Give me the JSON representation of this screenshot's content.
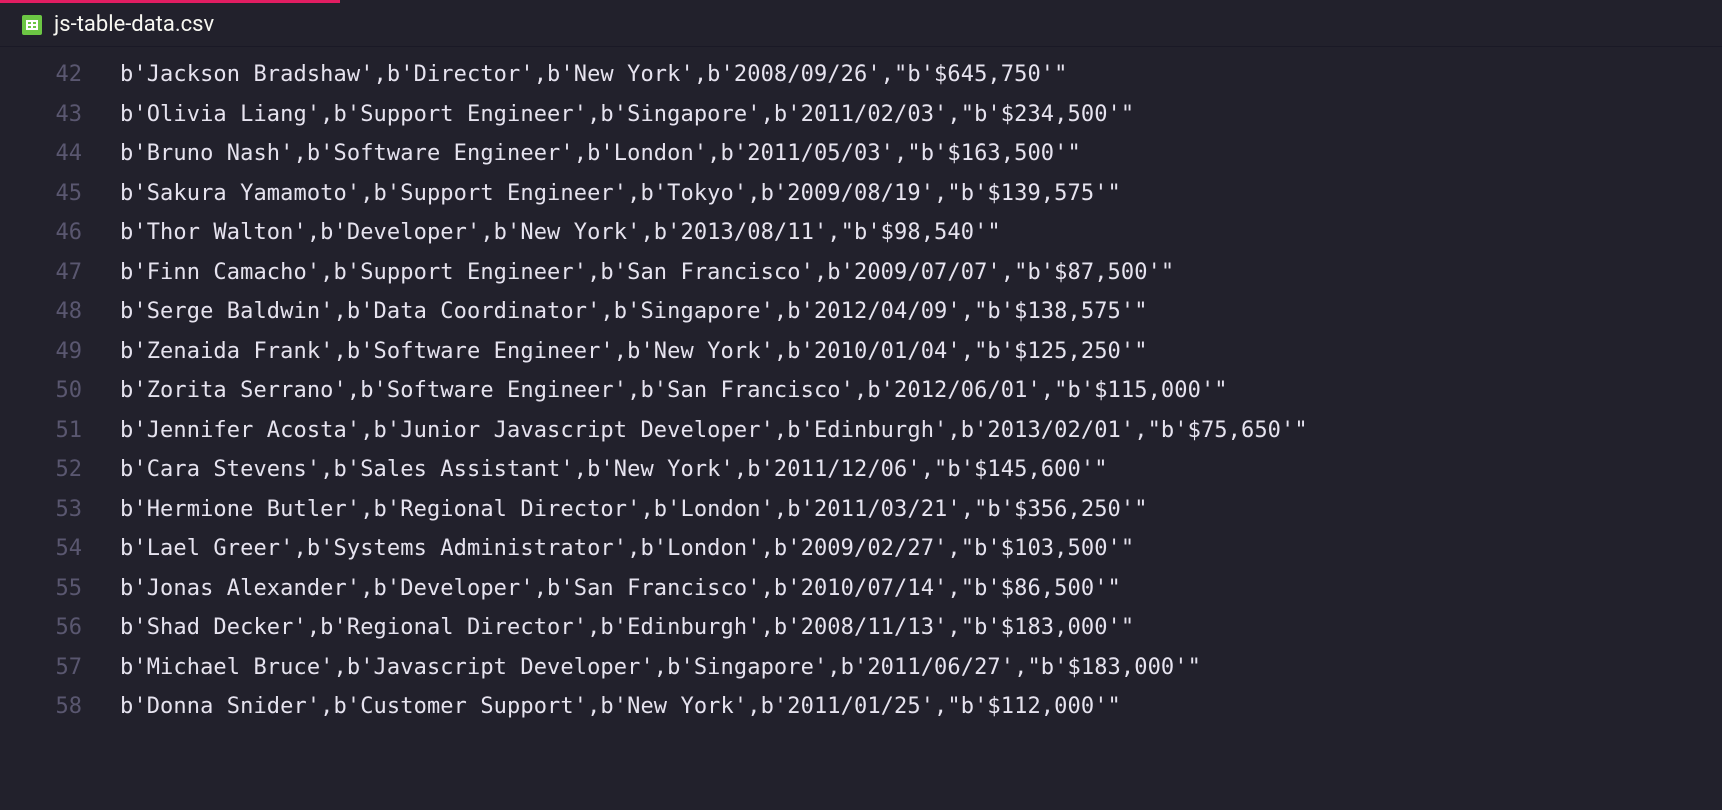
{
  "tab": {
    "filename": "js-table-data.csv"
  },
  "lines": [
    {
      "num": "42",
      "text": "b'Jackson Bradshaw',b'Director',b'New York',b'2008/09/26',\"b'$645,750'\""
    },
    {
      "num": "43",
      "text": "b'Olivia Liang',b'Support Engineer',b'Singapore',b'2011/02/03',\"b'$234,500'\""
    },
    {
      "num": "44",
      "text": "b'Bruno Nash',b'Software Engineer',b'London',b'2011/05/03',\"b'$163,500'\""
    },
    {
      "num": "45",
      "text": "b'Sakura Yamamoto',b'Support Engineer',b'Tokyo',b'2009/08/19',\"b'$139,575'\""
    },
    {
      "num": "46",
      "text": "b'Thor Walton',b'Developer',b'New York',b'2013/08/11',\"b'$98,540'\""
    },
    {
      "num": "47",
      "text": "b'Finn Camacho',b'Support Engineer',b'San Francisco',b'2009/07/07',\"b'$87,500'\""
    },
    {
      "num": "48",
      "text": "b'Serge Baldwin',b'Data Coordinator',b'Singapore',b'2012/04/09',\"b'$138,575'\""
    },
    {
      "num": "49",
      "text": "b'Zenaida Frank',b'Software Engineer',b'New York',b'2010/01/04',\"b'$125,250'\""
    },
    {
      "num": "50",
      "text": "b'Zorita Serrano',b'Software Engineer',b'San Francisco',b'2012/06/01',\"b'$115,000'\""
    },
    {
      "num": "51",
      "text": "b'Jennifer Acosta',b'Junior Javascript Developer',b'Edinburgh',b'2013/02/01',\"b'$75,650'\""
    },
    {
      "num": "52",
      "text": "b'Cara Stevens',b'Sales Assistant',b'New York',b'2011/12/06',\"b'$145,600'\""
    },
    {
      "num": "53",
      "text": "b'Hermione Butler',b'Regional Director',b'London',b'2011/03/21',\"b'$356,250'\""
    },
    {
      "num": "54",
      "text": "b'Lael Greer',b'Systems Administrator',b'London',b'2009/02/27',\"b'$103,500'\""
    },
    {
      "num": "55",
      "text": "b'Jonas Alexander',b'Developer',b'San Francisco',b'2010/07/14',\"b'$86,500'\""
    },
    {
      "num": "56",
      "text": "b'Shad Decker',b'Regional Director',b'Edinburgh',b'2008/11/13',\"b'$183,000'\""
    },
    {
      "num": "57",
      "text": "b'Michael Bruce',b'Javascript Developer',b'Singapore',b'2011/06/27',\"b'$183,000'\""
    },
    {
      "num": "58",
      "text": "b'Donna Snider',b'Customer Support',b'New York',b'2011/01/25',\"b'$112,000'\""
    }
  ]
}
